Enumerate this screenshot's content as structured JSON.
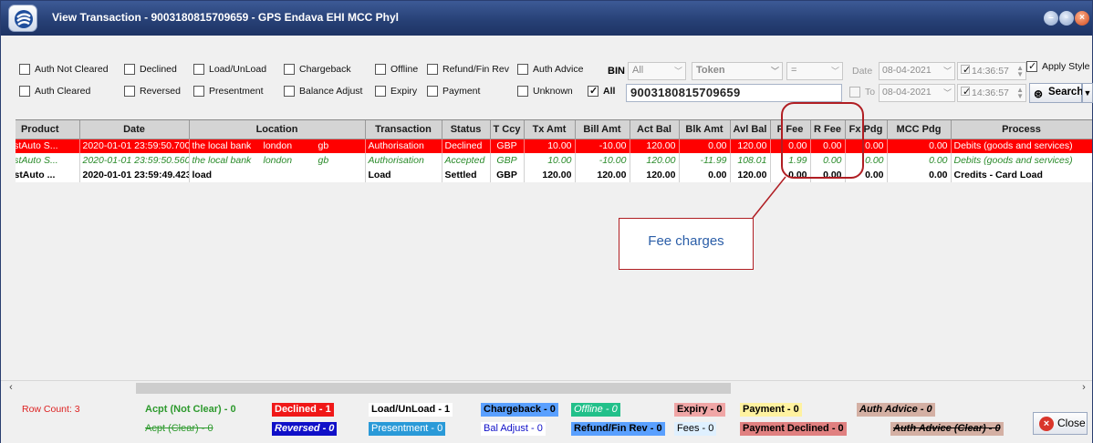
{
  "window": {
    "title": "View Transaction - 9003180815709659 - GPS Endava EHI MCC Phyl"
  },
  "filters": {
    "row1": [
      {
        "label": "Auth Not Cleared",
        "checked": false
      },
      {
        "label": "Declined",
        "checked": false
      },
      {
        "label": "Load/UnLoad",
        "checked": false
      },
      {
        "label": "Chargeback",
        "checked": false
      },
      {
        "label": "Offline",
        "checked": false
      },
      {
        "label": "Refund/Fin Rev",
        "checked": false
      },
      {
        "label": "Auth Advice",
        "checked": false
      }
    ],
    "row2": [
      {
        "label": "Auth Cleared",
        "checked": false
      },
      {
        "label": "Reversed",
        "checked": false
      },
      {
        "label": "Presentment",
        "checked": false
      },
      {
        "label": "Balance Adjust",
        "checked": false
      },
      {
        "label": "Expiry",
        "checked": false
      },
      {
        "label": "Payment",
        "checked": false
      },
      {
        "label": "Unknown",
        "checked": false
      },
      {
        "label": "All",
        "checked": true
      }
    ],
    "bin_label": "BIN",
    "bin_value": "All",
    "token_value": "Token",
    "operator_value": "=",
    "search_value": "9003180815709659",
    "date_label": "Date",
    "to_label": "To",
    "from_date": "08-04-2021",
    "from_time": "14:36:57",
    "to_date": "08-04-2021",
    "to_time": "14:36:57",
    "apply_style_label": "Apply Style",
    "apply_style_checked": true,
    "search_button": "Search"
  },
  "grid": {
    "columns": [
      "Product",
      "Date",
      "Location",
      "Transaction",
      "Status",
      "T Ccy",
      "Tx Amt",
      "Bill Amt",
      "Act Bal",
      "Blk Amt",
      "Avl Bal",
      "F Fee",
      "R Fee",
      "Fx Pdg",
      "MCC Pdg",
      "Process"
    ],
    "rows": [
      {
        "style": "declined",
        "product": "TestAuto S...",
        "date": "2020-01-01 23:59:50.700",
        "location": "the local bank",
        "city": "london",
        "country": "gb",
        "transaction": "Authorisation",
        "status": "Declined",
        "ccy": "GBP",
        "tx_amt": "10.00",
        "bill_amt": "-10.00",
        "act_bal": "120.00",
        "blk_amt": "0.00",
        "avl_bal": "120.00",
        "f_fee": "0.00",
        "r_fee": "0.00",
        "fx_pdg": "0.00",
        "mcc_pdg": "0.00",
        "process": "Debits (goods and services)"
      },
      {
        "style": "accepted",
        "product": "TestAuto S...",
        "date": "2020-01-01 23:59:50.560",
        "location": "the local bank",
        "city": "london",
        "country": "gb",
        "transaction": "Authorisation",
        "status": "Accepted",
        "ccy": "GBP",
        "tx_amt": "10.00",
        "bill_amt": "-10.00",
        "act_bal": "120.00",
        "blk_amt": "-11.99",
        "avl_bal": "108.01",
        "f_fee": "1.99",
        "r_fee": "0.00",
        "fx_pdg": "0.00",
        "mcc_pdg": "0.00",
        "process": "Debits (goods and services)"
      },
      {
        "style": "load",
        "product": "TestAuto ...",
        "date": "2020-01-01 23:59:49.423",
        "location": "load",
        "city": "",
        "country": "",
        "transaction": "Load",
        "status": "Settled",
        "ccy": "GBP",
        "tx_amt": "120.00",
        "bill_amt": "120.00",
        "act_bal": "120.00",
        "blk_amt": "0.00",
        "avl_bal": "120.00",
        "f_fee": "0.00",
        "r_fee": "0.00",
        "fx_pdg": "0.00",
        "mcc_pdg": "0.00",
        "process": "Credits - Card Load"
      }
    ]
  },
  "footer": {
    "row_count": "Row Count: 3",
    "legend": [
      {
        "text": "Acpt (Not Clear) - 0",
        "color": "#2e9a2e",
        "bg": "#f0f0f0",
        "bold": true
      },
      {
        "text": "Declined - 1",
        "color": "#ffffff",
        "bg": "#f01818",
        "bold": true
      },
      {
        "text": "Load/UnLoad - 1",
        "color": "#000000",
        "bg": "#ffffff",
        "bold": true
      },
      {
        "text": "Chargeback - 0",
        "color": "#000000",
        "bg": "#5aa0ff",
        "bold": true
      },
      {
        "text": "Offline - 0",
        "color": "#ffffff",
        "bg": "#22c08a",
        "italic": true
      },
      {
        "text": "Expiry - 0",
        "color": "#000000",
        "bg": "#f0a6a6",
        "bold": true
      },
      {
        "text": "Payment - 0",
        "color": "#000000",
        "bg": "#fff2a0",
        "bold": true
      },
      {
        "text": "Auth Advice - 0",
        "color": "#000000",
        "bg": "#d4b0a4",
        "bold": true,
        "italic": true
      },
      {
        "text": "Acpt (Clear) - 0",
        "color": "#2e9a2e",
        "bg": "#f0f0f0",
        "strike": true
      },
      {
        "text": "Reversed - 0",
        "color": "#ffffff",
        "bg": "#1010c8",
        "bold": true,
        "italic": true
      },
      {
        "text": "Presentment - 0",
        "color": "#ffffff",
        "bg": "#2a9ad8"
      },
      {
        "text": "Bal Adjust - 0",
        "color": "#1010c8",
        "bg": "#ffffff"
      },
      {
        "text": "Refund/Fin Rev - 0",
        "color": "#000000",
        "bg": "#5aa0ff",
        "bold": true
      },
      {
        "text": "Fees - 0",
        "color": "#000000",
        "bg": "#dff0ff"
      },
      {
        "text": "Payment Declined - 0",
        "color": "#000000",
        "bg": "#e08080",
        "bold": true
      },
      {
        "text": "Auth Advice (Clear) - 0",
        "color": "#000000",
        "bg": "#d4b0a4",
        "bold": true,
        "italic": true,
        "strike": true
      }
    ],
    "close_button": "Close"
  },
  "annotation": {
    "text": "Fee charges",
    "color": "#b01e23"
  }
}
